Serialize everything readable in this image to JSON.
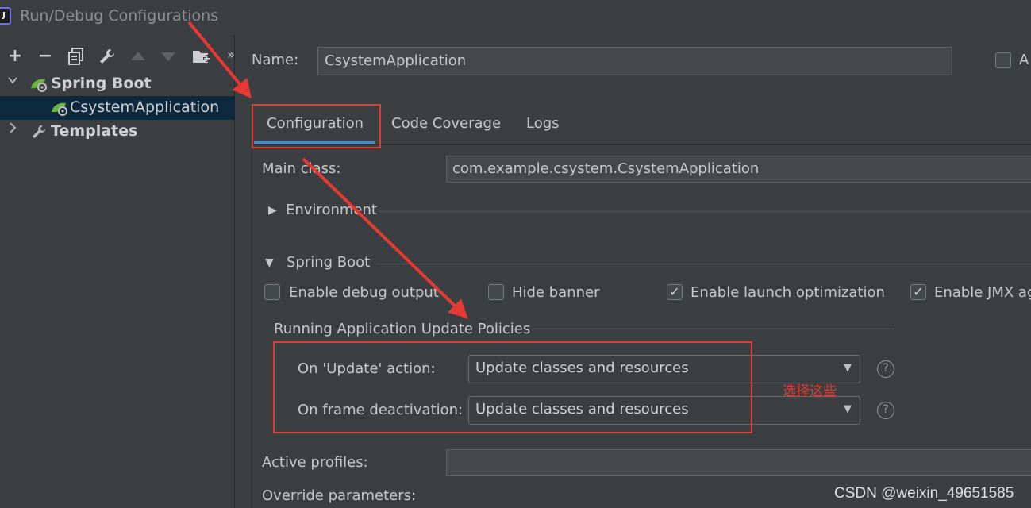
{
  "window": {
    "title": "Run/Debug Configurations",
    "app_icon_letter": "J"
  },
  "toolbar": {
    "add": "+",
    "remove": "−",
    "more": "»"
  },
  "tree": {
    "spring_boot": "Spring Boot",
    "csystem_app": "CsystemApplication",
    "templates": "Templates"
  },
  "name_row": {
    "label": "Name:",
    "value": "CsystemApplication",
    "allow_label": "A"
  },
  "tabs": [
    "Configuration",
    "Code Coverage",
    "Logs"
  ],
  "config": {
    "main_class_label": "Main class:",
    "main_class_value": "com.example.csystem.CsystemApplication",
    "environment": "Environment",
    "spring_boot_section": "Spring Boot",
    "checkboxes": [
      {
        "label": "Enable debug output",
        "checked": false
      },
      {
        "label": "Hide banner",
        "checked": false
      },
      {
        "label": "Enable launch optimization",
        "checked": true
      },
      {
        "label": "Enable JMX ag",
        "checked": true
      }
    ],
    "policies_title": "Running Application Update Policies",
    "on_update_label": "On 'Update' action:",
    "on_update_value": "Update classes and resources",
    "on_frame_label": "On frame deactivation:",
    "on_frame_value": "Update classes and resources",
    "help": "?",
    "active_profiles_label": "Active profiles:",
    "override_params_label": "Override parameters:"
  },
  "annotation": {
    "note": "选择这些",
    "color": "#e53935"
  },
  "watermark": "CSDN @weixin_49651585",
  "colors": {
    "background": "#3c3f41",
    "selection": "#0d293e",
    "tab_underline": "#4a88c7",
    "annotation_red": "#e53935"
  }
}
